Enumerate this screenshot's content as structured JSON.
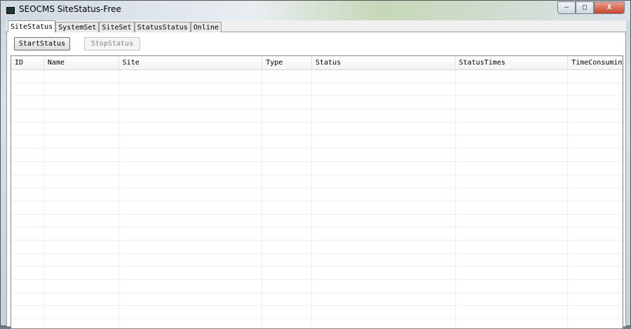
{
  "window": {
    "title": "SEOCMS SiteStatus-Free",
    "minimize": "▭",
    "maximize": "□",
    "close": "X"
  },
  "tabs": [
    {
      "label": "SiteStatus",
      "active": true
    },
    {
      "label": "SystemSet"
    },
    {
      "label": "SiteSet"
    },
    {
      "label": "StatusStatus"
    },
    {
      "label": "Online"
    }
  ],
  "toolbar": {
    "start_label": "StartStatus",
    "stop_label": "StopStatus"
  },
  "table": {
    "columns": [
      "ID",
      "Name",
      "Site",
      "Type",
      "Status",
      "StatusTimes",
      "TimeConsuming"
    ],
    "rows": []
  }
}
